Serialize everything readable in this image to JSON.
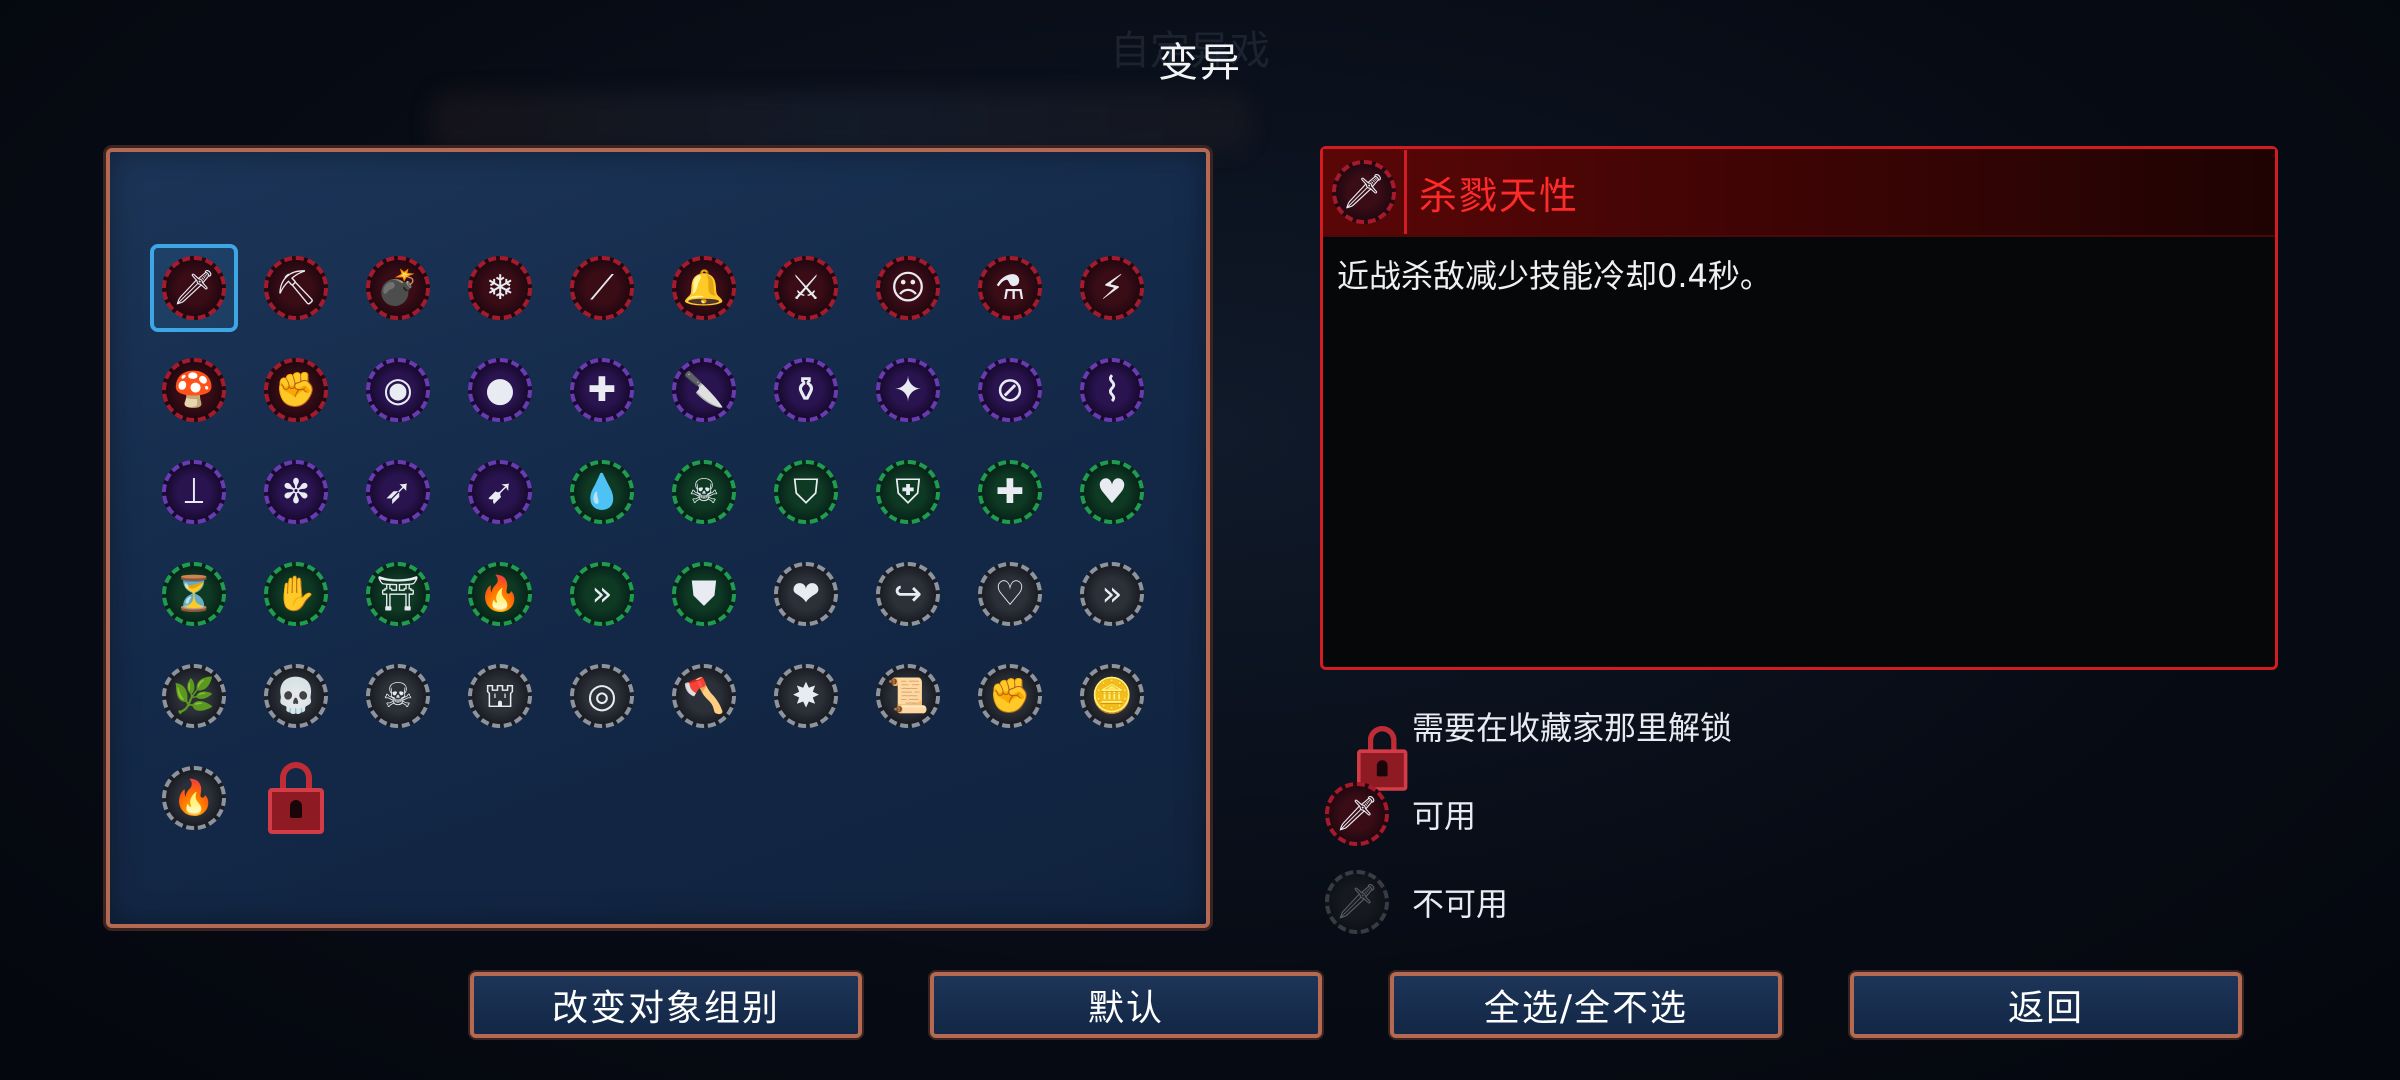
{
  "screen_title": "变异",
  "background_ghost_title": "自定异戏",
  "grid": {
    "selected_index": 0,
    "icons": [
      {
        "name": "sword-icon",
        "glyph": "🗡",
        "ring": "red"
      },
      {
        "name": "pickaxe-icon",
        "glyph": "⛏",
        "ring": "red"
      },
      {
        "name": "bomb-icon",
        "glyph": "💣",
        "ring": "red"
      },
      {
        "name": "scythe-ice-icon",
        "glyph": "❄",
        "ring": "red"
      },
      {
        "name": "claw-slash-icon",
        "glyph": "⟋",
        "ring": "red"
      },
      {
        "name": "bell-icon",
        "glyph": "🔔",
        "ring": "red"
      },
      {
        "name": "weapon-rack-icon",
        "glyph": "⚔",
        "ring": "red"
      },
      {
        "name": "angry-face-icon",
        "glyph": "☹",
        "ring": "red"
      },
      {
        "name": "blue-potion-icon",
        "glyph": "⚗",
        "ring": "red"
      },
      {
        "name": "lightning-icon",
        "glyph": "⚡",
        "ring": "red"
      },
      {
        "name": "mushroom-icon",
        "glyph": "🍄",
        "ring": "red"
      },
      {
        "name": "gauntlet-dagger-icon",
        "glyph": "✊",
        "ring": "red"
      },
      {
        "name": "ring-icon",
        "glyph": "◉",
        "ring": "purple"
      },
      {
        "name": "purple-bomb-icon",
        "glyph": "●",
        "ring": "purple"
      },
      {
        "name": "crosshair-icon",
        "glyph": "✚",
        "ring": "purple"
      },
      {
        "name": "knife-icon",
        "glyph": "🔪",
        "ring": "purple"
      },
      {
        "name": "green-flask-icon",
        "glyph": "⚱",
        "ring": "purple"
      },
      {
        "name": "star-burst-icon",
        "glyph": "✦",
        "ring": "purple"
      },
      {
        "name": "no-entry-icon",
        "glyph": "⊘",
        "ring": "purple"
      },
      {
        "name": "stairs-icon",
        "glyph": "⌇",
        "ring": "purple"
      },
      {
        "name": "blue-boot-icon",
        "glyph": "⟘",
        "ring": "purple"
      },
      {
        "name": "frost-hammer-icon",
        "glyph": "✼",
        "ring": "purple"
      },
      {
        "name": "bow-icon",
        "glyph": "➶",
        "ring": "purple"
      },
      {
        "name": "crossbow-fist-icon",
        "glyph": "➹",
        "ring": "purple"
      },
      {
        "name": "purple-drop-icon",
        "glyph": "💧",
        "ring": "green"
      },
      {
        "name": "skull-crossbones-icon",
        "glyph": "☠",
        "ring": "green"
      },
      {
        "name": "blue-shield-icon",
        "glyph": "⛉",
        "ring": "green"
      },
      {
        "name": "gold-shield-icon",
        "glyph": "⛨",
        "ring": "green"
      },
      {
        "name": "health-cross-icon",
        "glyph": "✚",
        "ring": "green"
      },
      {
        "name": "vampire-fangs-icon",
        "glyph": "♥",
        "ring": "green"
      },
      {
        "name": "hourglass-potion-icon",
        "glyph": "⏳",
        "ring": "green"
      },
      {
        "name": "torch-hand-icon",
        "glyph": "✋",
        "ring": "green"
      },
      {
        "name": "blue-gate-icon",
        "glyph": "⛩",
        "ring": "green"
      },
      {
        "name": "red-flame-icon",
        "glyph": "🔥",
        "ring": "green"
      },
      {
        "name": "double-chevron-icon",
        "glyph": "»",
        "ring": "green"
      },
      {
        "name": "fist-shield-icon",
        "glyph": "⛊",
        "ring": "green"
      },
      {
        "name": "red-heart-icon",
        "glyph": "❤",
        "ring": "gray"
      },
      {
        "name": "dash-icon",
        "glyph": "↪",
        "ring": "gray"
      },
      {
        "name": "green-heart-potion-icon",
        "glyph": "♡",
        "ring": "gray"
      },
      {
        "name": "gold-chevron-icon",
        "glyph": "»",
        "ring": "gray"
      },
      {
        "name": "green-leaf-icon",
        "glyph": "🌿",
        "ring": "gray"
      },
      {
        "name": "skull-glasses-icon",
        "glyph": "💀",
        "ring": "gray"
      },
      {
        "name": "skull-icon",
        "glyph": "☠",
        "ring": "gray"
      },
      {
        "name": "ice-gate-icon",
        "glyph": "⛫",
        "ring": "gray"
      },
      {
        "name": "purple-orb-icon",
        "glyph": "◎",
        "ring": "gray"
      },
      {
        "name": "axe-icon",
        "glyph": "🪓",
        "ring": "gray"
      },
      {
        "name": "gold-star-icon",
        "glyph": "✸",
        "ring": "gray"
      },
      {
        "name": "scroll-icon",
        "glyph": "📜",
        "ring": "gray"
      },
      {
        "name": "gold-fist-icon",
        "glyph": "✊",
        "ring": "gray"
      },
      {
        "name": "gold-coins-icon",
        "glyph": "🪙",
        "ring": "gray"
      },
      {
        "name": "fire-knife-icon",
        "glyph": "🔥",
        "ring": "gray"
      }
    ],
    "locked_icon": "lock-icon"
  },
  "detail": {
    "icon": "sword-icon",
    "icon_glyph": "🗡",
    "name": "杀戮天性",
    "description": "近战杀敌减少技能冷却0.4秒。"
  },
  "legend": {
    "locked": {
      "icon": "lock-icon",
      "label": "需要在收藏家那里解锁"
    },
    "available": {
      "icon": "sword-icon",
      "glyph": "🗡",
      "label": "可用"
    },
    "unavailable": {
      "icon": "sword-icon",
      "glyph": "🗡",
      "label": "不可用"
    }
  },
  "buttons": {
    "change_group": "改变对象组别",
    "default": "默认",
    "select_all": "全选/全不选",
    "back": "返回"
  },
  "colors": {
    "panel_border": "#b46a52",
    "detail_border": "#d21c22",
    "detail_title": "#ff2a2a",
    "selection": "#3fa6e6"
  }
}
